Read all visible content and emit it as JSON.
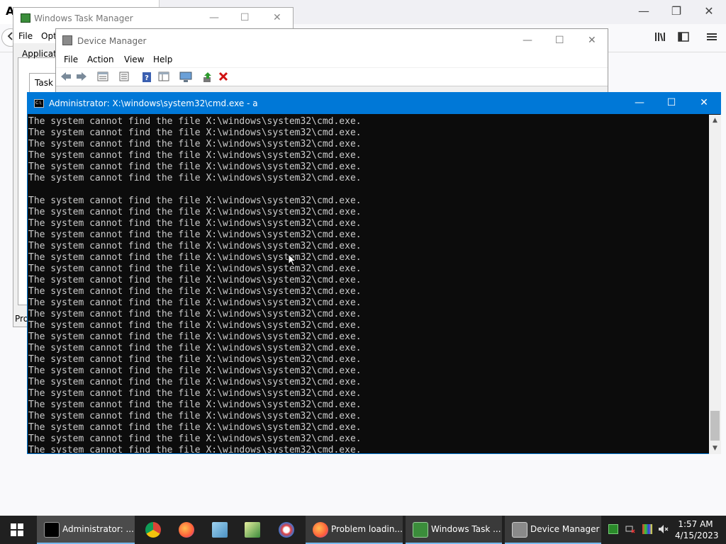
{
  "firefox_bg": {
    "tab_letter": "A",
    "controls": {
      "minimize": "—",
      "restore": "❐",
      "close": "✕"
    },
    "toolbar_icons": [
      "library-icon",
      "sidebar-icon",
      "menu-icon"
    ]
  },
  "task_manager": {
    "title": "Windows Task Manager",
    "menu": [
      "File",
      "Opti"
    ],
    "tab_label": "Application",
    "subtab_label": "Task",
    "status_text": "Pro",
    "controls": {
      "minimize": "—",
      "maximize": "☐",
      "close": "✕"
    }
  },
  "device_manager": {
    "title": "Device Manager",
    "menu": [
      "File",
      "Action",
      "View",
      "Help"
    ],
    "controls": {
      "minimize": "—",
      "maximize": "☐",
      "close": "✕"
    },
    "toolbar": [
      "back-icon",
      "forward-icon",
      "properties-icon",
      "list-icon",
      "help-icon",
      "view-icon",
      "scan-icon",
      "update-driver-icon",
      "uninstall-icon"
    ]
  },
  "cmd": {
    "title": "Administrator: X:\\windows\\system32\\cmd.exe - a",
    "icon_text": "C:\\",
    "controls": {
      "minimize": "—",
      "maximize": "☐",
      "close": "✕"
    },
    "lines": [
      "The system cannot find the file X:\\windows\\system32\\cmd.exe.",
      "The system cannot find the file X:\\windows\\system32\\cmd.exe.",
      "The system cannot find the file X:\\windows\\system32\\cmd.exe.",
      "The system cannot find the file X:\\windows\\system32\\cmd.exe.",
      "The system cannot find the file X:\\windows\\system32\\cmd.exe.",
      "The system cannot find the file X:\\windows\\system32\\cmd.exe.",
      "",
      "The system cannot find the file X:\\windows\\system32\\cmd.exe.",
      "The system cannot find the file X:\\windows\\system32\\cmd.exe.",
      "The system cannot find the file X:\\windows\\system32\\cmd.exe.",
      "The system cannot find the file X:\\windows\\system32\\cmd.exe.",
      "The system cannot find the file X:\\windows\\system32\\cmd.exe.",
      "The system cannot find the file X:\\windows\\system32\\cmd.exe.",
      "The system cannot find the file X:\\windows\\system32\\cmd.exe.",
      "The system cannot find the file X:\\windows\\system32\\cmd.exe.",
      "The system cannot find the file X:\\windows\\system32\\cmd.exe.",
      "The system cannot find the file X:\\windows\\system32\\cmd.exe.",
      "The system cannot find the file X:\\windows\\system32\\cmd.exe.",
      "The system cannot find the file X:\\windows\\system32\\cmd.exe.",
      "The system cannot find the file X:\\windows\\system32\\cmd.exe.",
      "The system cannot find the file X:\\windows\\system32\\cmd.exe.",
      "The system cannot find the file X:\\windows\\system32\\cmd.exe.",
      "The system cannot find the file X:\\windows\\system32\\cmd.exe.",
      "The system cannot find the file X:\\windows\\system32\\cmd.exe.",
      "The system cannot find the file X:\\windows\\system32\\cmd.exe.",
      "The system cannot find the file X:\\windows\\system32\\cmd.exe.",
      "The system cannot find the file X:\\windows\\system32\\cmd.exe.",
      "The system cannot find the file X:\\windows\\system32\\cmd.exe.",
      "The system cannot find the file X:\\windows\\system32\\cmd.exe.",
      "The system cannot find the file X:\\windows\\system32\\cmd.exe."
    ],
    "text_color": "#cccccc",
    "background": "#0c0c0c"
  },
  "taskbar": {
    "start_icon": "windows-logo-icon",
    "apps": [
      {
        "label": "Administrator: ...",
        "icon": "cmd-icon"
      },
      {
        "label": "Problem loadin...",
        "icon": "firefox-icon"
      },
      {
        "label": "Windows Task ...",
        "icon": "task-manager-icon"
      },
      {
        "label": "Device Manager",
        "icon": "device-manager-icon"
      }
    ],
    "pinned": [
      "chrome-icon",
      "firefox-icon",
      "notepad-icon",
      "registry-icon",
      "paint-icon"
    ],
    "tray": [
      "task-manager-tray-icon",
      "network-icon",
      "display-icon",
      "volume-muted-icon"
    ],
    "time": "1:57 AM",
    "date": "4/15/2023"
  },
  "colors": {
    "accent": "#0078d7",
    "taskbar": "#202020"
  }
}
